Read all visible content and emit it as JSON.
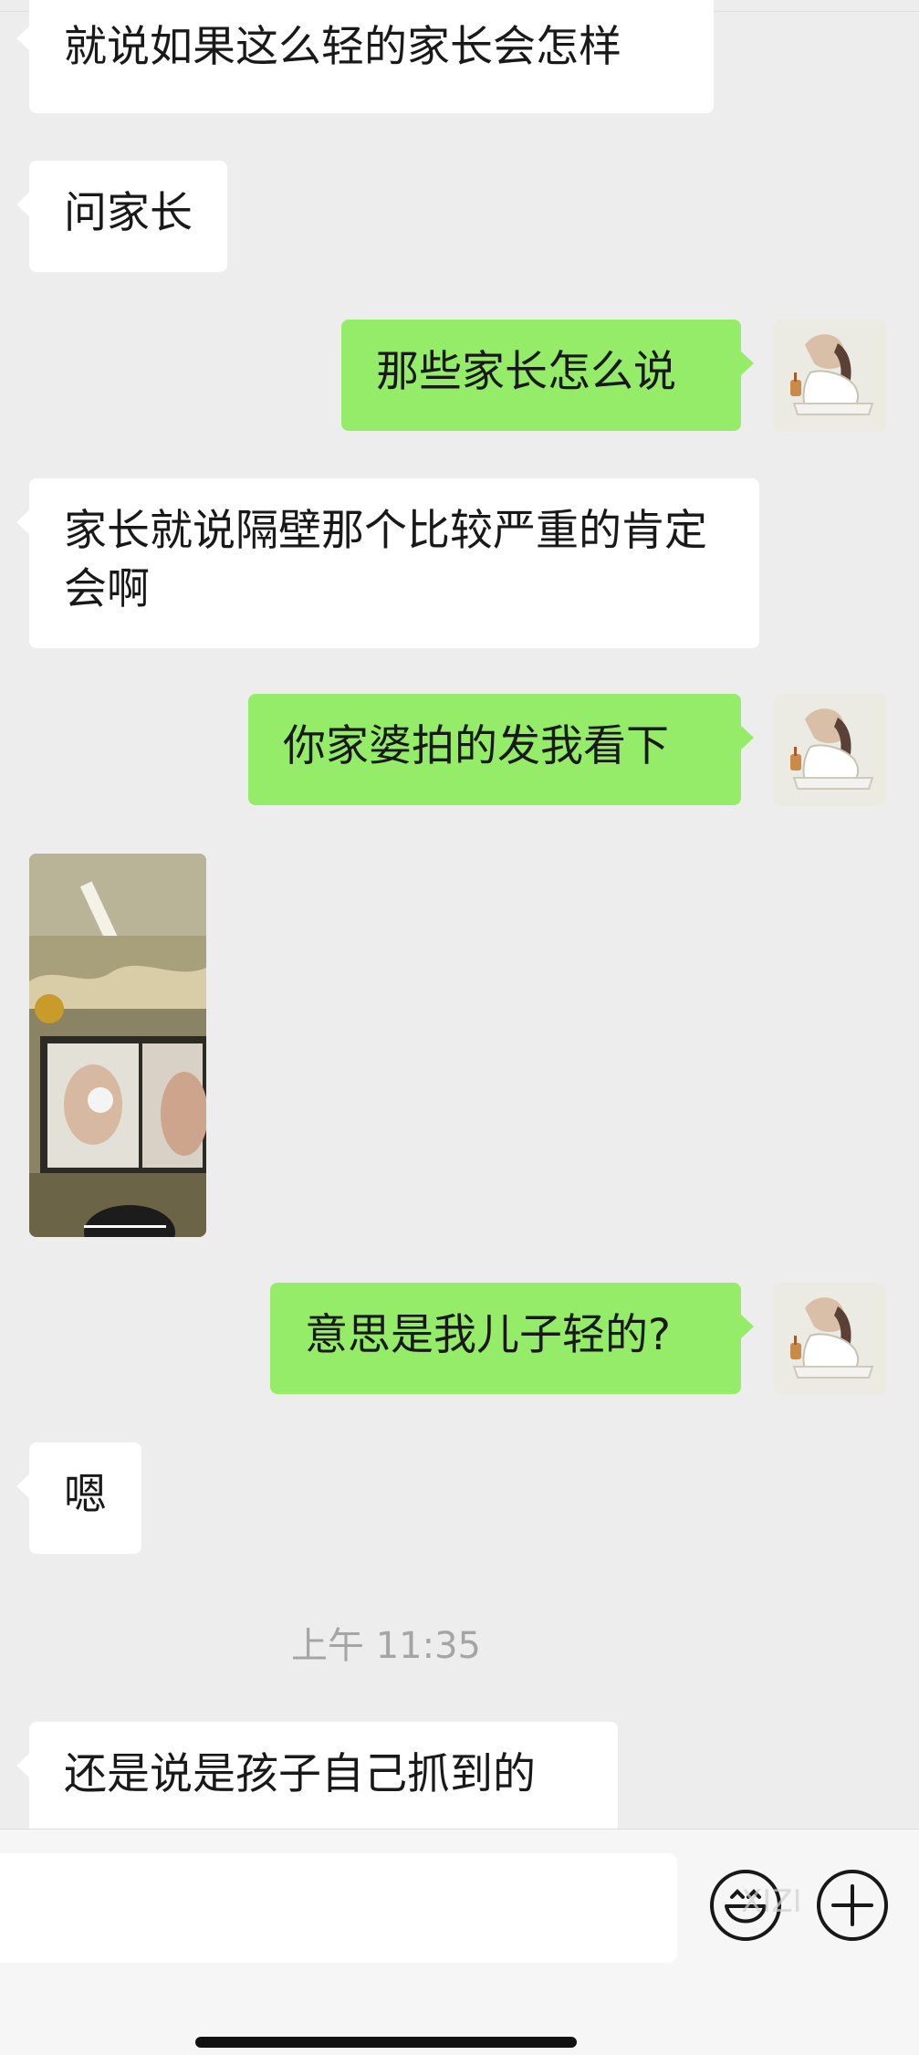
{
  "messages": [
    {
      "text": "就说如果这么轻的家长会怎样"
    },
    {
      "text": "问家长"
    },
    {
      "text": "那些家长怎么说"
    },
    {
      "text": "家长就说隔壁那个比较严重的肯定会啊"
    },
    {
      "text": "你家婆拍的发我看下"
    },
    {
      "text": "意思是我儿子轻的?"
    },
    {
      "text": "嗯"
    },
    {
      "text": "还是说是孩子自己抓到的"
    }
  ],
  "timestamp": "上午 11:35",
  "watermark": "XIZI",
  "input": {
    "value": "",
    "placeholder": ""
  },
  "icons": {
    "emoji": "emoji-icon",
    "plus": "plus-icon"
  },
  "colors": {
    "background": "#ededed",
    "outgoing_bubble": "#95ec69",
    "incoming_bubble": "#ffffff"
  }
}
